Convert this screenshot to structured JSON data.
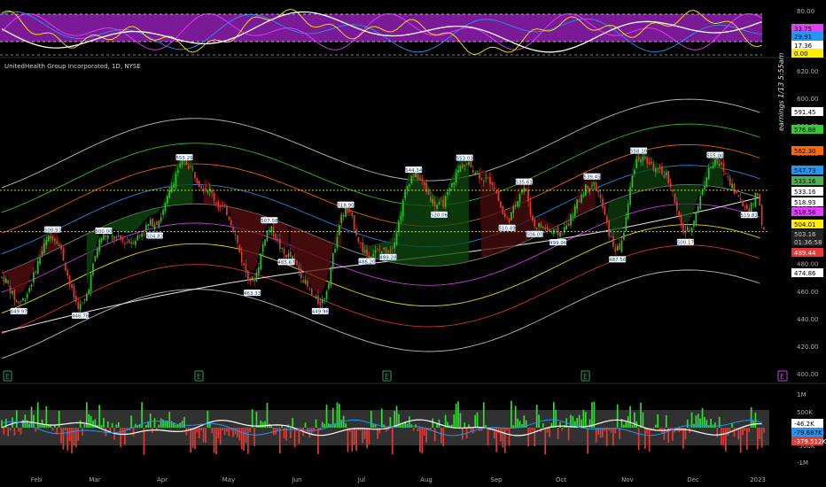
{
  "chart_data": {
    "type": "candlestick",
    "symbol_title": "UnitedHealth Group Incorporated, 1D, NYSE",
    "earnings_note": "earnings 1/13 5:55am",
    "price_axis": {
      "ticks": [
        400,
        420,
        440,
        460,
        480,
        500,
        520,
        540,
        560,
        580,
        600,
        620
      ],
      "range": [
        400,
        628
      ]
    },
    "time_axis": {
      "labels": [
        "Feb",
        "Mar",
        "Apr",
        "May",
        "Jun",
        "Jul",
        "Aug",
        "Sep",
        "Oct",
        "Nov",
        "Dec",
        "2023"
      ]
    },
    "price_badges": [
      {
        "value": "591.45",
        "color": "#ffffff",
        "text_color": "#000000"
      },
      {
        "value": "576.88",
        "color": "#33cc33",
        "text_color": "#000000"
      },
      {
        "value": "562.30",
        "color": "#ff6a00",
        "text_color": "#000000"
      },
      {
        "value": "547.73",
        "color": "#2196f3",
        "text_color": "#000000"
      },
      {
        "value": "533.16",
        "color": "#4caf50",
        "text_color": "#000000"
      },
      {
        "value": "533.16",
        "color": "#ffffff",
        "text_color": "#000000"
      },
      {
        "value": "518.93",
        "color": "#ffffff",
        "text_color": "#000000"
      },
      {
        "value": "518.58",
        "color": "#e040fb",
        "text_color": "#000000"
      },
      {
        "value": "504.01",
        "color": "#ffee00",
        "text_color": "#000000"
      },
      {
        "value": "503.16",
        "color": "#222222",
        "text_color": "#cccccc"
      },
      {
        "value": "01:36:58",
        "color": "#222222",
        "text_color": "#cccccc"
      },
      {
        "value": "489.44",
        "color": "#e53935",
        "text_color": "#ffffff"
      },
      {
        "value": "474.86",
        "color": "#ffffff",
        "text_color": "#000000"
      }
    ],
    "osc_pane": {
      "ticks": [
        "80.00"
      ],
      "badges": [
        {
          "value": "33.75",
          "color": "#e040fb",
          "text_color": "#000000"
        },
        {
          "value": "29.91",
          "color": "#2196f3",
          "text_color": "#000000"
        },
        {
          "value": "17.36",
          "color": "#ffffff",
          "text_color": "#000000"
        },
        {
          "value": "0.00",
          "color": "#ffee00",
          "text_color": "#000000"
        }
      ]
    },
    "volume_pane": {
      "ticks": [
        "1M",
        "500K",
        "0",
        "-500K",
        "-1M"
      ],
      "badges": [
        {
          "value": "-46.2K",
          "color": "#ffffff",
          "text_color": "#000000"
        },
        {
          "value": "-79.687K",
          "color": "#2196f3",
          "text_color": "#000000"
        },
        {
          "value": "-379.512K",
          "color": "#e53935",
          "text_color": "#ffffff"
        }
      ]
    },
    "swing_labels": [
      {
        "label": "449.97",
        "date_index": 8,
        "price": 449.97,
        "side": "low"
      },
      {
        "label": "500.93",
        "date_index": 24,
        "price": 500.93,
        "side": "high"
      },
      {
        "label": "446.78",
        "date_index": 37,
        "price": 446.78,
        "side": "low"
      },
      {
        "label": "500.00",
        "date_index": 48,
        "price": 500.0,
        "side": "high"
      },
      {
        "label": "504.83",
        "date_index": 72,
        "price": 504.83,
        "side": "low"
      },
      {
        "label": "553.29",
        "date_index": 86,
        "price": 553.29,
        "side": "high"
      },
      {
        "label": "507.58",
        "date_index": 126,
        "price": 507.58,
        "side": "high"
      },
      {
        "label": "463.33",
        "date_index": 118,
        "price": 463.33,
        "side": "low"
      },
      {
        "label": "485.67",
        "date_index": 134,
        "price": 485.67,
        "side": "low"
      },
      {
        "label": "449.96",
        "date_index": 150,
        "price": 449.96,
        "side": "low"
      },
      {
        "label": "518.90",
        "date_index": 162,
        "price": 518.9,
        "side": "high"
      },
      {
        "label": "486.20",
        "date_index": 172,
        "price": 486.2,
        "side": "low"
      },
      {
        "label": "489.28",
        "date_index": 182,
        "price": 489.28,
        "side": "low"
      },
      {
        "label": "544.34",
        "date_index": 194,
        "price": 544.34,
        "side": "high"
      },
      {
        "label": "520.06",
        "date_index": 206,
        "price": 520.06,
        "side": "low"
      },
      {
        "label": "553.03",
        "date_index": 218,
        "price": 553.03,
        "side": "high"
      },
      {
        "label": "510.49",
        "date_index": 238,
        "price": 510.49,
        "side": "low"
      },
      {
        "label": "535.61",
        "date_index": 246,
        "price": 535.61,
        "side": "high"
      },
      {
        "label": "506.00",
        "date_index": 251,
        "price": 506.0,
        "side": "low"
      },
      {
        "label": "499.96",
        "date_index": 262,
        "price": 499.96,
        "side": "low"
      },
      {
        "label": "539.45",
        "date_index": 278,
        "price": 539.45,
        "side": "high"
      },
      {
        "label": "487.56",
        "date_index": 290,
        "price": 487.56,
        "side": "low"
      },
      {
        "label": "558.10",
        "date_index": 300,
        "price": 558.1,
        "side": "high"
      },
      {
        "label": "500.17",
        "date_index": 322,
        "price": 500.17,
        "side": "low"
      },
      {
        "label": "555.00",
        "date_index": 336,
        "price": 555.0,
        "side": "high"
      },
      {
        "label": "519.82",
        "date_index": 352,
        "price": 519.82,
        "side": "low"
      }
    ],
    "earnings_markers": [
      "E",
      "E",
      "E",
      "E",
      "E"
    ],
    "current_price": 503.16,
    "upper_dotted_level": 533.16,
    "colors": {
      "up_candle": "#26c426",
      "down_candle": "#e53935",
      "background": "#000000",
      "osc_band": "#8b1fa8",
      "grid_text": "#aaaaaa"
    }
  }
}
